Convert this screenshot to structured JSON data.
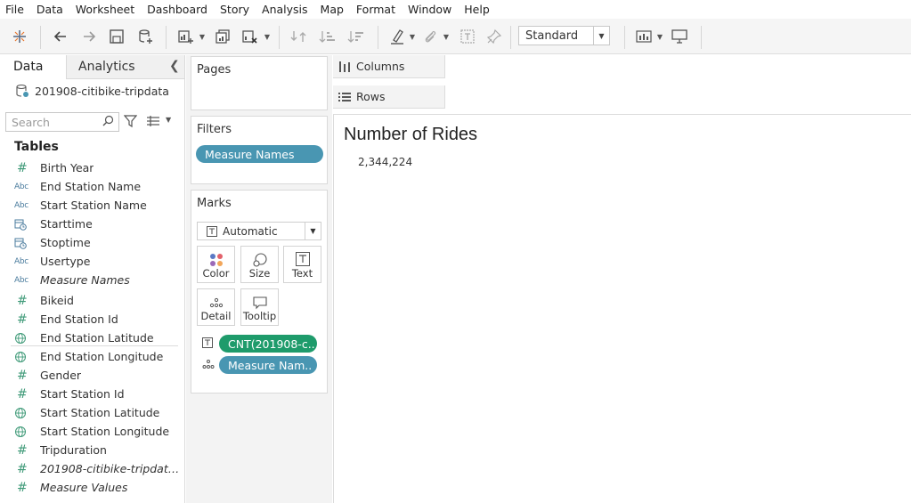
{
  "menu": [
    "File",
    "Data",
    "Worksheet",
    "Dashboard",
    "Story",
    "Analysis",
    "Map",
    "Format",
    "Window",
    "Help"
  ],
  "toolbar": {
    "view_mode": "Standard",
    "icons": [
      "tableau-logo-icon",
      "undo-icon",
      "redo-icon",
      "save-icon",
      "new-datasource-icon",
      "new-worksheet-icon",
      "duplicate-sheet-icon",
      "clear-sheet-icon",
      "swap-icon",
      "sort-ascending-icon",
      "sort-descending-icon",
      "highlight-icon",
      "paperclip-icon",
      "text-label-icon",
      "pin-icon",
      "show-me-icon",
      "presentation-icon"
    ]
  },
  "left_panel": {
    "tab_data": "Data",
    "tab_analytics": "Analytics",
    "datasource": "201908-citibike-tripdata",
    "search_placeholder": "Search",
    "tables_heading": "Tables",
    "dimensions": [
      {
        "name": "Birth Year",
        "type": "number"
      },
      {
        "name": "End Station Name",
        "type": "string"
      },
      {
        "name": "Start Station Name",
        "type": "string"
      },
      {
        "name": "Starttime",
        "type": "datetime"
      },
      {
        "name": "Stoptime",
        "type": "datetime"
      },
      {
        "name": "Usertype",
        "type": "string"
      },
      {
        "name": "Measure Names",
        "type": "string",
        "italic": true
      }
    ],
    "measures": [
      {
        "name": "Bikeid",
        "type": "number"
      },
      {
        "name": "End Station Id",
        "type": "number"
      },
      {
        "name": "End Station Latitude",
        "type": "geo"
      },
      {
        "name": "End Station Longitude",
        "type": "geo"
      },
      {
        "name": "Gender",
        "type": "number"
      },
      {
        "name": "Start Station Id",
        "type": "number"
      },
      {
        "name": "Start Station Latitude",
        "type": "geo"
      },
      {
        "name": "Start Station Longitude",
        "type": "geo"
      },
      {
        "name": "Tripduration",
        "type": "number"
      },
      {
        "name": "201908-citibike-tripdata.c...",
        "type": "number",
        "italic": true
      },
      {
        "name": "Measure Values",
        "type": "number",
        "italic": true
      }
    ]
  },
  "cards": {
    "pages_title": "Pages",
    "filters_title": "Filters",
    "filter_pill": "Measure Names",
    "marks_title": "Marks",
    "mark_type": "Automatic",
    "buttons": [
      "Color",
      "Size",
      "Text",
      "Detail",
      "Tooltip"
    ],
    "mark_pills": [
      "CNT(201908-c..",
      "Measure Nam.."
    ]
  },
  "shelves": {
    "columns": "Columns",
    "rows": "Rows"
  },
  "view": {
    "title": "Number of Rides",
    "value": "2,344,224"
  },
  "colors": {
    "blue_pill": "#4996b2",
    "green_pill": "#1e9b6b",
    "measure_icon": "#3f9a78",
    "dimension_icon": "#4a7b9d"
  }
}
